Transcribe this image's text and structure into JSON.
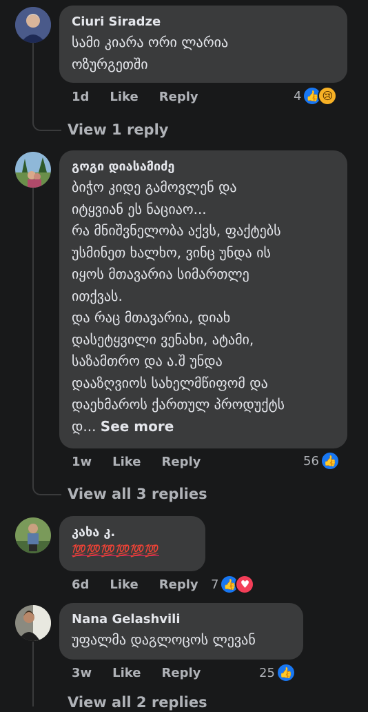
{
  "comments": [
    {
      "author": "Ciuri Siradze",
      "text": "სამი კიარა ორი ლარია\nოზურგეთში",
      "time": "1d",
      "like": "Like",
      "reply": "Reply",
      "reaction_count": "4",
      "reactions": [
        "like-icon",
        "sad-icon"
      ],
      "view_replies": "View 1 reply"
    },
    {
      "author": "გოგი დიასამიძე",
      "text": "ბიჭო კიდე გამოვლენ და\nიტყვიან ეს ნაციაო...\nრა მნიშვნელობა აქვს, ფაქტებს\nუსმინეთ ხალხო, ვინც უნდა ის\nიყოს მთავარია სიმართლე\nითქვას.\nდა რაც მთავარია, დიახ\nდასეტყვილი ვენახი, ატამი,\nსაზამთრო და ა.შ უნდა\nდააზღვიოს სახელმწიფომ და\nდაეხმაროს ქართულ პროდუქტს\nდ...",
      "see_more": "See more",
      "time": "1w",
      "like": "Like",
      "reply": "Reply",
      "reaction_count": "56",
      "reactions": [
        "like-icon"
      ],
      "view_replies": "View all 3 replies"
    },
    {
      "author": "კახა კ.",
      "text": "💯💯💯💯💯💯",
      "time": "6d",
      "like": "Like",
      "reply": "Reply",
      "reaction_count": "7",
      "reactions": [
        "like-icon",
        "heart-icon"
      ]
    },
    {
      "author": "Nana Gelashvili",
      "text": "უფალმა დაგლოცოს ლევან",
      "time": "3w",
      "like": "Like",
      "reply": "Reply",
      "reaction_count": "25",
      "reactions": [
        "like-icon"
      ],
      "view_replies": "View all 2 replies"
    }
  ],
  "colors": {
    "background": "#18191a",
    "bubble": "#3a3b3c",
    "like_blue": "#1877f2",
    "heart_red": "#f33e58"
  }
}
